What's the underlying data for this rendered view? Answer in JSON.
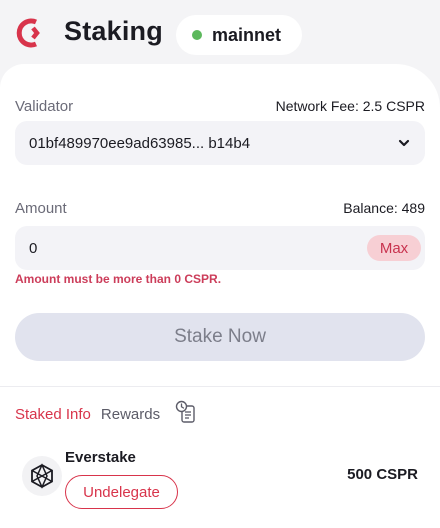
{
  "header": {
    "title": "Staking",
    "network": "mainnet",
    "network_status_color": "#5cb85c",
    "brand_color": "#d8344b"
  },
  "validator": {
    "label": "Validator",
    "network_fee": "Network Fee: 2.5 CSPR",
    "selected": "01bf489970ee9ad63985... b14b4"
  },
  "amount": {
    "label": "Amount",
    "balance": "Balance: 489",
    "value": "0",
    "max_label": "Max",
    "error": "Amount must be more than 0 CSPR."
  },
  "actions": {
    "stake_label": "Stake Now"
  },
  "tabs": [
    {
      "label": "Staked Info",
      "active": true
    },
    {
      "label": "Rewards",
      "active": false
    }
  ],
  "staked": [
    {
      "name": "Everstake",
      "amount": "500 CSPR",
      "action_label": "Undelegate"
    }
  ]
}
